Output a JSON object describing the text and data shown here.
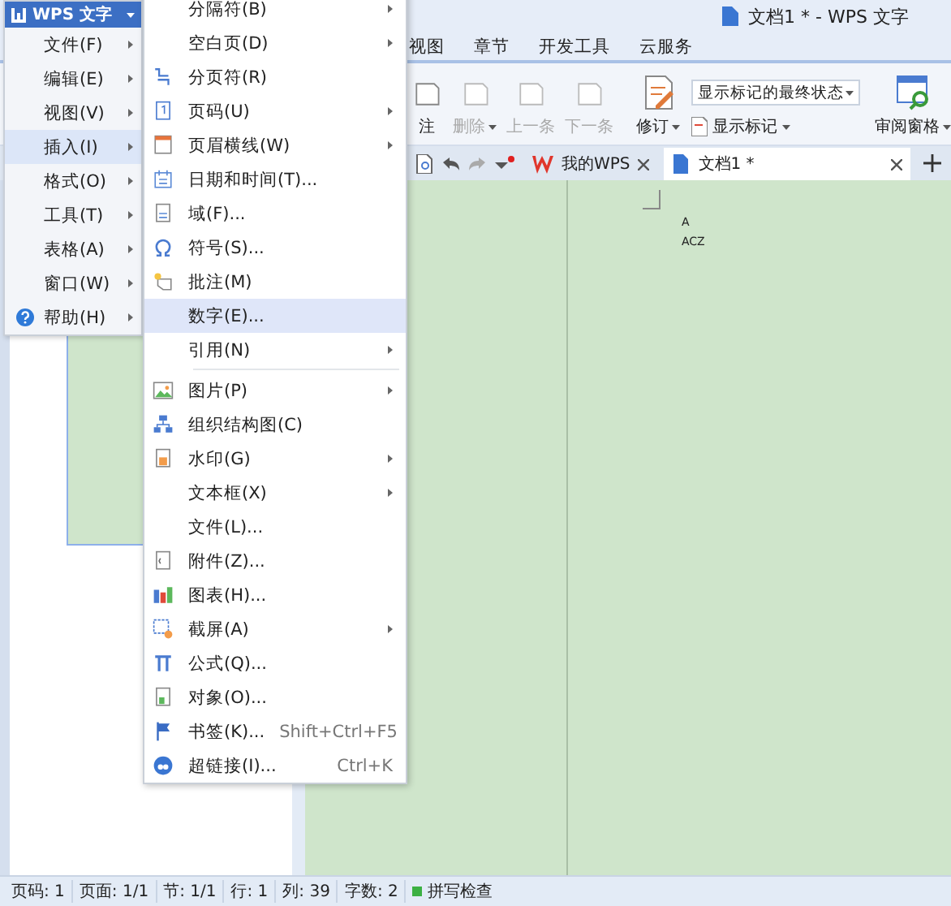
{
  "window": {
    "title": "文档1 * - WPS 文字"
  },
  "ribbon_tabs": [
    {
      "label": "视图"
    },
    {
      "label": "章节"
    },
    {
      "label": "开发工具"
    },
    {
      "label": "云服务"
    }
  ],
  "ribbon": {
    "buttons": [
      {
        "label": "注",
        "disabled": false,
        "dropdown": false
      },
      {
        "label": "删除",
        "disabled": true,
        "dropdown": true
      },
      {
        "label": "上一条",
        "disabled": true,
        "dropdown": false
      },
      {
        "label": "下一条",
        "disabled": true,
        "dropdown": false
      },
      {
        "label": "修订",
        "disabled": false,
        "dropdown": true
      }
    ],
    "markup_select": {
      "value": "显示标记的最终状态"
    },
    "show_markup": {
      "label": "显示标记"
    },
    "review_pane": {
      "label": "审阅窗格"
    }
  },
  "doc_tabs": [
    {
      "label": "我的WPS",
      "selected": false
    },
    {
      "label": "文档1 *",
      "selected": true
    }
  ],
  "document": {
    "lines": [
      "A",
      "ACZ"
    ]
  },
  "app_menu": {
    "title": "WPS 文字",
    "items": [
      {
        "label": "文件(F)",
        "selected": false
      },
      {
        "label": "编辑(E)",
        "selected": false
      },
      {
        "label": "视图(V)",
        "selected": false
      },
      {
        "label": "插入(I)",
        "selected": true
      },
      {
        "label": "格式(O)",
        "selected": false
      },
      {
        "label": "工具(T)",
        "selected": false
      },
      {
        "label": "表格(A)",
        "selected": false
      },
      {
        "label": "窗口(W)",
        "selected": false
      },
      {
        "label": "帮助(H)",
        "selected": false
      }
    ]
  },
  "insert_menu": {
    "items": [
      {
        "kind": "item",
        "label": "分隔符(B)",
        "submenu": true,
        "selected": false
      },
      {
        "kind": "item",
        "label": "空白页(D)",
        "submenu": true,
        "selected": false
      },
      {
        "kind": "item",
        "label": "分页符(R)",
        "submenu": false,
        "selected": false
      },
      {
        "kind": "item",
        "label": "页码(U)",
        "submenu": true,
        "selected": false
      },
      {
        "kind": "item",
        "label": "页眉横线(W)",
        "submenu": true,
        "selected": false
      },
      {
        "kind": "item",
        "label": "日期和时间(T)...",
        "submenu": false,
        "selected": false
      },
      {
        "kind": "item",
        "label": "域(F)...",
        "submenu": false,
        "selected": false
      },
      {
        "kind": "item",
        "label": "符号(S)...",
        "submenu": false,
        "selected": false
      },
      {
        "kind": "item",
        "label": "批注(M)",
        "submenu": false,
        "selected": false
      },
      {
        "kind": "item",
        "label": "数字(E)...",
        "submenu": false,
        "selected": true
      },
      {
        "kind": "item",
        "label": "引用(N)",
        "submenu": true,
        "selected": false
      },
      {
        "kind": "separator"
      },
      {
        "kind": "item",
        "label": "图片(P)",
        "submenu": true,
        "selected": false
      },
      {
        "kind": "item",
        "label": "组织结构图(C)",
        "submenu": false,
        "selected": false
      },
      {
        "kind": "item",
        "label": "水印(G)",
        "submenu": true,
        "selected": false
      },
      {
        "kind": "item",
        "label": "文本框(X)",
        "submenu": true,
        "selected": false
      },
      {
        "kind": "item",
        "label": "文件(L)...",
        "submenu": false,
        "selected": false
      },
      {
        "kind": "item",
        "label": "附件(Z)...",
        "submenu": false,
        "selected": false
      },
      {
        "kind": "item",
        "label": "图表(H)...",
        "submenu": false,
        "selected": false
      },
      {
        "kind": "item",
        "label": "截屏(A)",
        "submenu": true,
        "selected": false
      },
      {
        "kind": "item",
        "label": "公式(Q)...",
        "submenu": false,
        "selected": false
      },
      {
        "kind": "item",
        "label": "对象(O)...",
        "submenu": false,
        "selected": false
      },
      {
        "kind": "item",
        "label": "书签(K)...",
        "submenu": false,
        "selected": false,
        "shortcut": "Shift+Ctrl+F5"
      },
      {
        "kind": "item",
        "label": "超链接(I)...",
        "submenu": false,
        "selected": false,
        "shortcut": "Ctrl+K"
      }
    ]
  },
  "status_bar": {
    "fields": [
      "页码: 1",
      "页面: 1/1",
      "节: 1/1",
      "行: 1",
      "列: 39",
      "字数: 2"
    ],
    "spell_check": {
      "label": "拼写检查",
      "on": true
    }
  }
}
